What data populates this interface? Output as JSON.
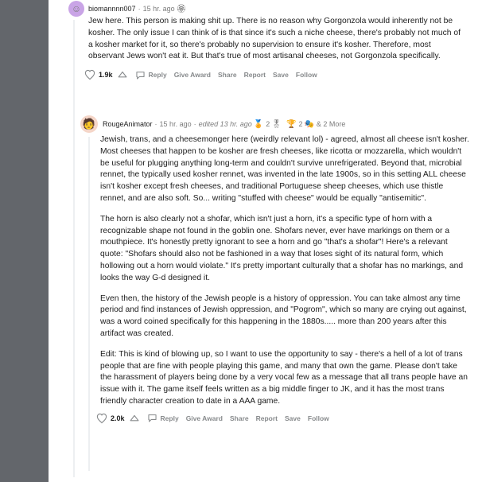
{
  "comment1": {
    "username": "biomannnn007",
    "time": "15 hr. ago",
    "body": "Jew here. This person is making shit up. There is no reason why Gorgonzola would inherently not be kosher. The only issue I can think of is that since it's such a niche cheese, there's probably not much of a kosher market for it, so there's probably no supervision to ensure it's kosher. Therefore, most observant Jews won't eat it. But that's true of most artisanal cheeses, not Gorgonzola specifically.",
    "votes": "1.9k",
    "actions": [
      "Reply",
      "Give Award",
      "Share",
      "Report",
      "Save",
      "Follow"
    ]
  },
  "comment2": {
    "username": "RougeAnimator",
    "time": "15 hr. ago",
    "edited": "edited 13 hr. ago",
    "awards": [
      "2",
      "2",
      "& 2 More"
    ],
    "paragraphs": [
      "Jewish, trans, and a cheesemonger here (weirdly relevant lol) - agreed, almost all cheese isn't kosher. Most cheeses that happen to be kosher are fresh cheeses, like ricotta or mozzarella, which wouldn't be useful for plugging anything long-term and couldn't survive unrefrigerated. Beyond that, microbial rennet, the typically used kosher rennet, was invented in the late 1900s, so in this setting ALL cheese isn't kosher except fresh cheeses, and traditional Portuguese sheep cheeses, which use thistle rennet, and are also soft. So... writing \"stuffed with cheese\" would be equally \"antisemitic\".",
      "The horn is also clearly not a shofar, which isn't just a horn, it's a specific type of horn with a recognizable shape not found in the goblin one. Shofars never, ever have markings on them or a mouthpiece. It's honestly pretty ignorant to see a horn and go \"that's a shofar\"! Here's a relevant quote: \"Shofars should also not be fashioned in a way that loses sight of its natural form, which hollowing out a horn would violate.\" It's pretty important culturally that a shofar has no markings, and looks the way G-d designed it.",
      "Even then, the history of the Jewish people is a history of oppression. You can take almost any time period and find instances of Jewish oppression, and \"Pogrom\", which so many are crying out against, was a word coined specifically for this happening in the 1880s..... more than 200 years after this artifact was created.",
      "Edit: This is kind of blowing up, so I want to use the opportunity to say - there's a hell of a lot of trans people that are fine with people playing this game, and many that own the game. Please don't take the harassment of players being done by a very vocal few as a message that all trans people have an issue with it. The game itself feels written as a big middle finger to JK, and it has the most trans friendly character creation to date in a AAA game."
    ],
    "votes": "2.0k",
    "actions": [
      "Reply",
      "Give Award",
      "Share",
      "Report",
      "Save",
      "Follow"
    ]
  },
  "icons": [
    "upvote-icon",
    "downvote-icon",
    "reply-icon",
    "award-icon"
  ]
}
